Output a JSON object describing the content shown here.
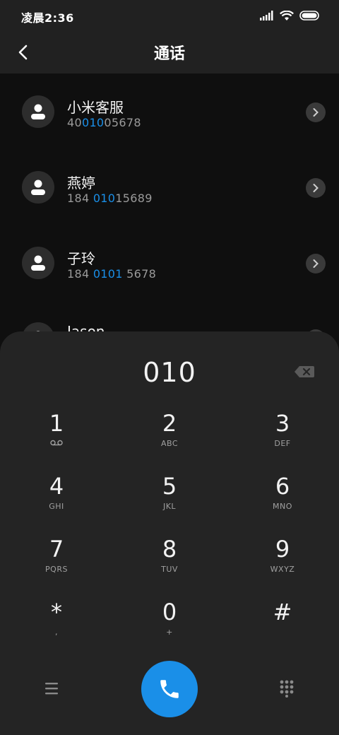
{
  "status": {
    "time": "凌晨2:36"
  },
  "header": {
    "title": "通话"
  },
  "contacts": [
    {
      "name": "小米客服",
      "num_pre": "40",
      "num_hl": "010",
      "num_post": "05678"
    },
    {
      "name": "燕婷",
      "num_pre": "184 ",
      "num_hl": "010",
      "num_post": "15689"
    },
    {
      "name": "子玲",
      "num_pre": "184 ",
      "num_hl": "0101",
      "num_post": " 5678"
    },
    {
      "name": "Jason",
      "num_pre": "",
      "num_hl": "",
      "num_post": ""
    }
  ],
  "dialpad": {
    "input": "010",
    "keys": [
      {
        "digit": "1",
        "sub": ""
      },
      {
        "digit": "2",
        "sub": "ABC"
      },
      {
        "digit": "3",
        "sub": "DEF"
      },
      {
        "digit": "4",
        "sub": "GHI"
      },
      {
        "digit": "5",
        "sub": "JKL"
      },
      {
        "digit": "6",
        "sub": "MNO"
      },
      {
        "digit": "7",
        "sub": "PQRS"
      },
      {
        "digit": "8",
        "sub": "TUV"
      },
      {
        "digit": "9",
        "sub": "WXYZ"
      },
      {
        "digit": "*",
        "sub": ","
      },
      {
        "digit": "0",
        "sub": "+"
      },
      {
        "digit": "#",
        "sub": ""
      }
    ]
  },
  "colors": {
    "accent": "#1a8fe8",
    "background": "#0f0f0f",
    "panel": "#242424"
  }
}
